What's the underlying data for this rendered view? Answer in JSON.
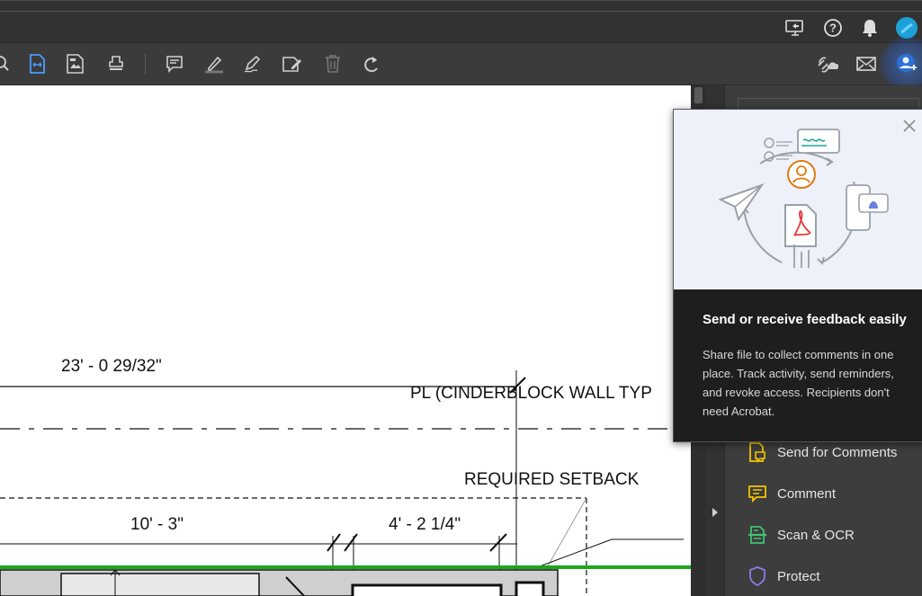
{
  "toolbar": {
    "tools": [
      "zoom-icon",
      "fit-width-icon",
      "image-page-icon",
      "stamp-icon",
      "comment-icon",
      "highlight-icon",
      "sign-icon",
      "edit-text-icon",
      "delete-icon",
      "redo-icon"
    ],
    "right_tools": [
      "share-link-icon",
      "email-icon",
      "share-user-icon"
    ]
  },
  "topbar": {
    "icons": [
      "screen-share-icon",
      "help-icon",
      "notification-bell-icon",
      "profile-avatar-icon"
    ]
  },
  "drawing": {
    "dim_top": "23' - 0 29/32\"",
    "pl_label": "PL (CINDERBLOCK WALL TYP",
    "setback_label": "REQUIRED SETBACK",
    "dim_left": "10' - 3\"",
    "dim_right": "4' - 2 1/4\""
  },
  "popover": {
    "title": "Send or receive feedback easily",
    "body": "Share file to collect comments in one place. Track activity, send reminders, and revoke access. Recipients don't need Acrobat."
  },
  "right_panel": {
    "items": [
      {
        "label": "Send for Comments",
        "icon": "send-comments-icon",
        "color": "#f5c400"
      },
      {
        "label": "Comment",
        "icon": "comment-icon",
        "color": "#f5c400"
      },
      {
        "label": "Scan & OCR",
        "icon": "scan-icon",
        "color": "#3ec46d"
      },
      {
        "label": "Protect",
        "icon": "shield-icon",
        "color": "#8d7ae6"
      }
    ]
  },
  "colors": {
    "accent_blue": "#4b9cff",
    "green_line": "#1aa81a"
  }
}
